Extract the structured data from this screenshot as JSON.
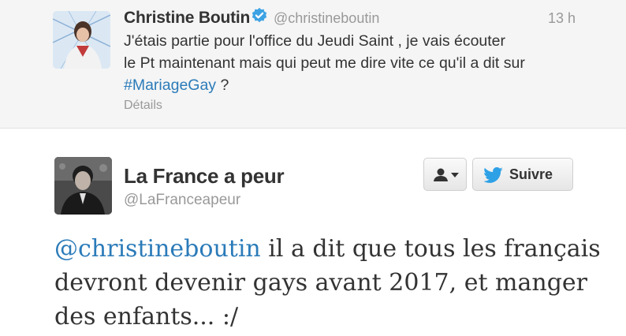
{
  "tweet_top": {
    "name": "Christine Boutin",
    "handle": "@christineboutin",
    "time": "13 h",
    "text_line1": "J'étais partie pour l'office du Jeudi Saint , je vais écouter",
    "text_line2": "le Pt maintenant mais qui peut me dire vite ce qu'il a dit sur",
    "hashtag": "#MariageGay",
    "text_end": " ?",
    "details": "Détails"
  },
  "tweet_main": {
    "name": "La France a peur",
    "handle": "@LaFranceapeur",
    "follow_label": "Suivre",
    "mention": "@christineboutin",
    "text_rest": " il a dit que tous les français devront devenir gays avant 2017, et manger des enfants... :/"
  },
  "icons": {
    "verified": "verified-badge-icon",
    "user_menu": "person-icon",
    "bird": "twitter-bird-icon"
  },
  "colors": {
    "link": "#2b7bb9",
    "verified": "#3da2e4",
    "bird": "#2ea1e6"
  }
}
